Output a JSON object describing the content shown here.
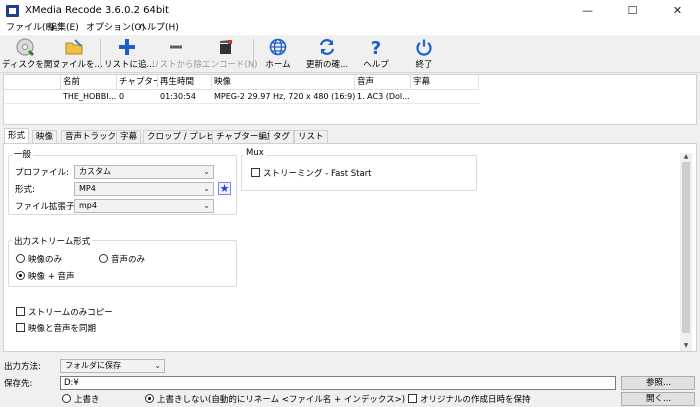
{
  "window": {
    "title": "XMedia Recode 3.6.0.2 64bit",
    "minimize": "—",
    "maximize": "☐",
    "close": "✕"
  },
  "menu": [
    "ファイル(F)",
    "編集(E)",
    "オプション(O)",
    "ヘルプ(H)"
  ],
  "toolbar": {
    "open_disc": "ディスクを開く",
    "open_file": "ファイルを...",
    "add_list": "リストに追...",
    "remove_list": "リストから除...",
    "encode": "エンコード(N)",
    "home": "ホーム",
    "update": "更新の確...",
    "help": "ヘルプ",
    "exit": "終了"
  },
  "filelist": {
    "columns": [
      "名前",
      "チャプター",
      "再生時間",
      "映像",
      "音声",
      "字幕"
    ],
    "rows": [
      {
        "name": "THE_HOBBI...",
        "chapter": "0",
        "duration": "01:30:54",
        "video": "MPEG-2 29.97 Hz, 720 x 480 (16:9), ...",
        "audio": "1. AC3 (Dol...",
        "subtitle": ""
      }
    ]
  },
  "tabs": [
    "形式",
    "映像",
    "音声トラック 1",
    "字幕",
    "クロップ / プレビュー",
    "チャプター編集",
    "タグ",
    "リスト"
  ],
  "general": {
    "title": "一般",
    "profile_label": "プロファイル:",
    "profile_value": "カスタム",
    "format_label": "形式:",
    "format_value": "MP4",
    "ext_label": "ファイル拡張子:",
    "ext_value": "mp4"
  },
  "mux": {
    "title": "Mux",
    "streaming": "ストリーミング - Fast Start"
  },
  "output_stream": {
    "title": "出力ストリーム形式",
    "video_only": "映像のみ",
    "audio_only": "音声のみ",
    "video_audio": "映像 + 音声"
  },
  "options": {
    "stream_copy": "ストリームのみコピー",
    "sync": "映像と音声を同期"
  },
  "bottom": {
    "output_method_label": "出力方法:",
    "output_method_value": "フォルダに保存",
    "save_to_label": "保存先:",
    "save_to_value": "D:¥",
    "browse": "参照...",
    "open": "開く...",
    "overwrite": "上書き",
    "no_overwrite": "上書きしない(自動的にリネーム <ファイル名 + インデックス>)",
    "keep_date": "オリジナルの作成日時を保持"
  },
  "colors": {
    "accent": "#1a5fd0",
    "star": "#2a3fd6"
  }
}
